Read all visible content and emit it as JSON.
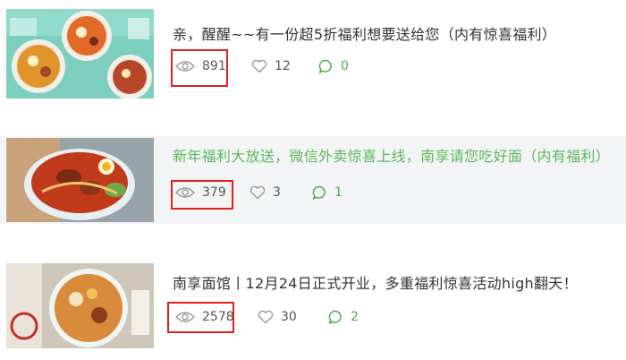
{
  "articles": [
    {
      "title": "亲，醒醒~~有一份超5折福利想要送给您（内有惊喜福利）",
      "views": "891",
      "likes": "12",
      "comments": "0",
      "title_color": "#333333",
      "highlighted": true
    },
    {
      "title": "新年福利大放送，微信外卖惊喜上线，南享请您吃好面（内有福利）",
      "views": "379",
      "likes": "3",
      "comments": "1",
      "title_color": "#5cb85c",
      "highlighted": true
    },
    {
      "title": "南享面馆丨12月24日正式开业，多重福利惊喜活动high翻天！",
      "views": "2578",
      "likes": "30",
      "comments": "2",
      "title_color": "#333333",
      "highlighted": true
    }
  ],
  "icons": {
    "views": "eye-icon",
    "likes": "heart-icon",
    "comments": "comment-icon"
  },
  "colors": {
    "highlight_border": "#e0201c",
    "comment_green": "#4cae4c",
    "row_alt_bg": "#f3f4f5"
  }
}
